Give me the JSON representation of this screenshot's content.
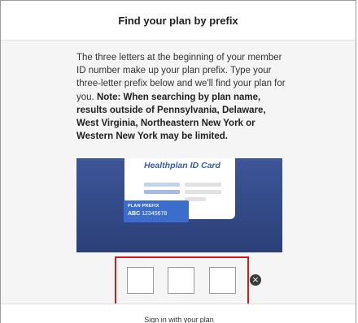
{
  "modal": {
    "title": "Find your plan by prefix",
    "intro": "The three letters at the beginning of your member ID number make up your plan prefix. Type your three-letter prefix below and we'll find your plan for you.",
    "note": "Note: When searching by plan name, results outside of Pennsylvania, Delaware, West Virginia, Northeastern New York or Western New York may be limited."
  },
  "illustration": {
    "card_title": "Healthplan ID Card",
    "tag_label": "PLAN PREFIX",
    "tag_prefix": "ABC",
    "tag_number": "12345678"
  },
  "prefix_inputs": {
    "values": [
      "",
      "",
      ""
    ],
    "clear_icon": "x-circle-icon"
  },
  "footer": {
    "signin_link": "Sign in with your plan"
  },
  "colors": {
    "illustration_bg": "#2f4682",
    "tag_bg": "#3c6ccc",
    "card_title": "#3a5ba6",
    "highlight_frame": "#cc1f1f"
  }
}
